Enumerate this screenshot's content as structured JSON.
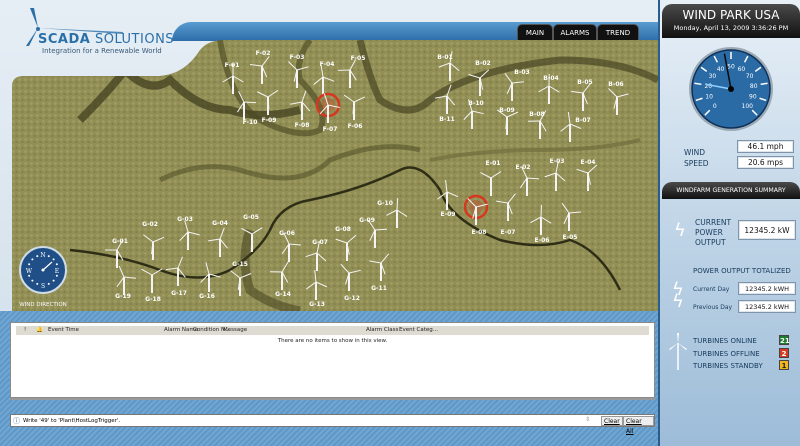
{
  "brand": {
    "name_bold": "SCADA",
    "name_rest": " SOLUTIONS",
    "tagline": "Integration for a Renewable World"
  },
  "nav": {
    "tabs": [
      {
        "label": "MAIN"
      },
      {
        "label": "ALARMS"
      },
      {
        "label": "TREND"
      }
    ]
  },
  "park": {
    "title": "WIND PARK USA",
    "datetime": "Monday, April 13, 2009 3:36:26 PM"
  },
  "gauge": {
    "min": 0,
    "max": 100,
    "ticks": [
      "0",
      "10",
      "20",
      "30",
      "40",
      "50",
      "60",
      "70",
      "80",
      "90",
      "100"
    ],
    "needle_primary": 46.1,
    "needle_secondary": 20.6,
    "face_color": "#2a6aa5"
  },
  "wind": {
    "label_line1": "WIND",
    "label_line2": "SPEED",
    "mph": "46.1 mph",
    "mps": "20.6  mps"
  },
  "summary": {
    "title": "WINDFARM GENERATION SUMMARY",
    "current_label": [
      "CURRENT",
      "POWER",
      "OUTPUT"
    ],
    "current_value": "12345.2 kW",
    "totalized_title": "POWER OUTPUT TOTALIZED",
    "current_day_label": "Current Day",
    "current_day_value": "12345.2 kWH",
    "previous_day_label": "Previous Day",
    "previous_day_value": "12345.2 kWH",
    "online_label": "TURBINES ONLINE",
    "online": "21",
    "online_color": "#1e7a2e",
    "offline_label": "TURBINES OFFLINE",
    "offline": "2",
    "offline_color": "#d63a1f",
    "standby_label": "TURBINES STANDBY",
    "standby": "1",
    "standby_color": "#f2b51c"
  },
  "map": {
    "wind_direction_label": "WIND DIRECTION",
    "compass": [
      "N",
      "E",
      "S",
      "W"
    ],
    "alarm_color": "#d8361f",
    "turbines": [
      {
        "id": "F-01"
      },
      {
        "id": "F-02"
      },
      {
        "id": "F-03"
      },
      {
        "id": "F-04"
      },
      {
        "id": "F-05"
      },
      {
        "id": "F-06"
      },
      {
        "id": "F-07",
        "alarm": true
      },
      {
        "id": "F-08"
      },
      {
        "id": "F-09"
      },
      {
        "id": "F-10"
      },
      {
        "id": "B-01"
      },
      {
        "id": "B-02"
      },
      {
        "id": "B-03"
      },
      {
        "id": "B-04"
      },
      {
        "id": "B-05"
      },
      {
        "id": "B-06"
      },
      {
        "id": "B-07"
      },
      {
        "id": "B-08"
      },
      {
        "id": "B-09"
      },
      {
        "id": "B-10"
      },
      {
        "id": "B-11"
      },
      {
        "id": "E-01"
      },
      {
        "id": "E-02"
      },
      {
        "id": "E-03"
      },
      {
        "id": "E-04"
      },
      {
        "id": "E-05"
      },
      {
        "id": "E-06"
      },
      {
        "id": "E-07"
      },
      {
        "id": "E-08",
        "alarm": true
      },
      {
        "id": "E-09"
      },
      {
        "id": "G-01"
      },
      {
        "id": "G-02"
      },
      {
        "id": "G-03"
      },
      {
        "id": "G-04"
      },
      {
        "id": "G-05"
      },
      {
        "id": "G-06"
      },
      {
        "id": "G-07"
      },
      {
        "id": "G-08"
      },
      {
        "id": "G-09"
      },
      {
        "id": "G-10"
      },
      {
        "id": "G-11"
      },
      {
        "id": "G-12"
      },
      {
        "id": "G-13"
      },
      {
        "id": "G-14"
      },
      {
        "id": "G-15"
      },
      {
        "id": "G-16"
      },
      {
        "id": "G-17"
      },
      {
        "id": "G-18"
      },
      {
        "id": "G-19"
      }
    ]
  },
  "alarms": {
    "columns": [
      "!",
      "🔔",
      "Event Time",
      "Alarm Name",
      "Condition N...",
      "Message",
      "Alarm Class",
      "Event Categ..."
    ],
    "empty_text": "There are no items to show in this view."
  },
  "statusbar": {
    "message": "Write '49' to 'Plant\\HostLogTrigger'.",
    "clear": "Clear",
    "clear_all": "Clear All"
  }
}
